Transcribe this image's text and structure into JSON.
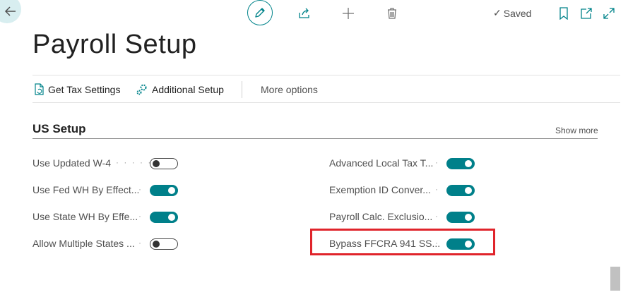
{
  "toolbar": {
    "saved_label": "Saved"
  },
  "page": {
    "title": "Payroll Setup"
  },
  "actions": {
    "get_tax_settings": "Get Tax Settings",
    "additional_setup": "Additional Setup",
    "more_options": "More options"
  },
  "section": {
    "title": "US Setup",
    "show_more": "Show more"
  },
  "fields_left": [
    {
      "label": "Use Updated W-4",
      "dots": "· · · · · ·",
      "on": false
    },
    {
      "label": "Use Fed WH By Effect...",
      "dots": "·",
      "on": true
    },
    {
      "label": "Use State WH By Effe...",
      "dots": "·",
      "on": true
    },
    {
      "label": "Allow Multiple States ...",
      "dots": "·",
      "on": false
    }
  ],
  "fields_right": [
    {
      "label": "Advanced Local Tax T...",
      "dots": "·",
      "on": true
    },
    {
      "label": "Exemption ID Conver...",
      "dots": "·",
      "on": true
    },
    {
      "label": "Payroll Calc. Exclusio...",
      "dots": "·",
      "on": true
    },
    {
      "label": "Bypass FFCRA 941 SS...",
      "dots": "·",
      "on": true
    }
  ],
  "colors": {
    "accent": "#00808a",
    "highlight": "#e0242b"
  }
}
